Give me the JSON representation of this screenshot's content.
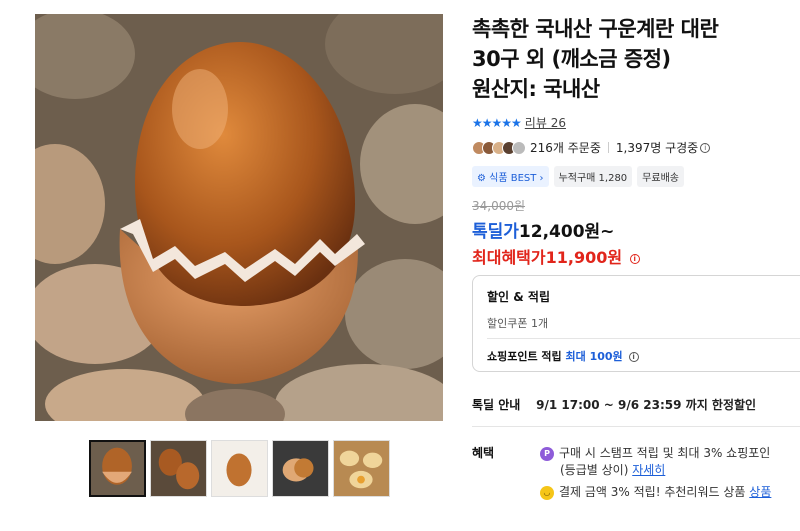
{
  "product": {
    "title_line1": "촉촉한 국내산 구운계란 대란",
    "title_line2": "30구 외 (깨소금 증정)",
    "title_line3": "원산지: 국내산"
  },
  "review": {
    "stars": "★★★★★",
    "link": "리뷰 26"
  },
  "stats": {
    "orders": "216개 주문중",
    "views": "1,397명 구경중"
  },
  "badges": {
    "best": "식품 BEST",
    "cumulative": "누적구매 1,280",
    "shipping": "무료배송"
  },
  "price": {
    "original": "34,000원",
    "deal_label": "톡딜가",
    "deal_value": "12,400원~",
    "max_label": "최대혜택가",
    "max_value": "11,900원"
  },
  "benefit_box": {
    "title": "할인 & 적립",
    "coupon": "할인쿠폰 1개",
    "point_prefix": "쇼핑포인트 적립",
    "point_highlight": "최대 100원"
  },
  "deal_info": {
    "label": "톡딜 안내",
    "period": "9/1 17:00 ~ 9/6 23:59 까지 한정할인"
  },
  "benefits": {
    "label": "혜택",
    "row1": "구매 시 스탬프 적립 및 최대 3% 쇼핑포인",
    "row1b": "(등급별 상이)",
    "row1_link": "자세히",
    "row2": "결제 금액 3% 적립! 추천리워드 상품",
    "row2_link": "상품"
  },
  "icons": {
    "info": "i",
    "point_coin": "P",
    "reward_coin": "◡"
  },
  "colors": {
    "accent_blue": "#1d5fd8",
    "sale_red": "#e1251b"
  }
}
